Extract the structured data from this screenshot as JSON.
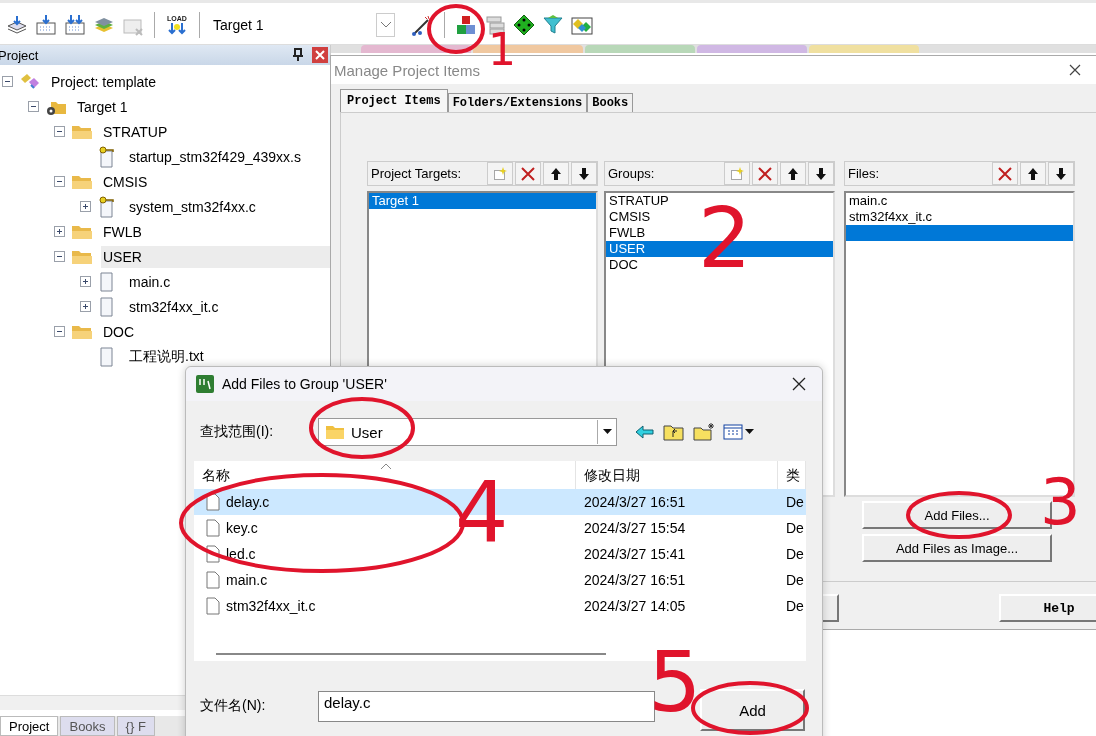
{
  "toolbar": {
    "load_label": "LOAD",
    "target": "Target 1"
  },
  "project_panel": {
    "title": "Project",
    "tree": [
      {
        "label": "Project: template",
        "kind": "project",
        "expanded": true,
        "selected": false,
        "children": [
          {
            "label": "Target 1",
            "kind": "target",
            "expanded": true,
            "selected": false,
            "children": [
              {
                "label": "STRATUP",
                "kind": "group",
                "expanded": true,
                "selected": false,
                "children": [
                  {
                    "label": "startup_stm32f429_439xx.s",
                    "kind": "keyfile",
                    "selected": false
                  }
                ]
              },
              {
                "label": "CMSIS",
                "kind": "group",
                "expanded": true,
                "selected": false,
                "children": [
                  {
                    "label": "system_stm32f4xx.c",
                    "kind": "keyfile",
                    "expanded": false,
                    "selected": false
                  }
                ]
              },
              {
                "label": "FWLB",
                "kind": "group",
                "expanded": false,
                "selected": false
              },
              {
                "label": "USER",
                "kind": "group",
                "expanded": true,
                "selected": true,
                "children": [
                  {
                    "label": "main.c",
                    "kind": "file",
                    "expanded": false,
                    "selected": false
                  },
                  {
                    "label": "stm32f4xx_it.c",
                    "kind": "file",
                    "expanded": false,
                    "selected": false
                  }
                ]
              },
              {
                "label": "DOC",
                "kind": "group",
                "expanded": true,
                "selected": false,
                "children": [
                  {
                    "label": "工程说明.txt",
                    "kind": "file",
                    "selected": false
                  }
                ]
              }
            ]
          }
        ]
      }
    ],
    "tabs": [
      {
        "label": "Project",
        "selected": true
      },
      {
        "label": "Books",
        "selected": false
      },
      {
        "label": "{} F",
        "selected": false
      }
    ]
  },
  "manage_dialog": {
    "title": "Manage Project Items",
    "tabs": [
      {
        "label": "Project Items",
        "selected": true
      },
      {
        "label": "Folders/Extensions",
        "selected": false
      },
      {
        "label": "Books",
        "selected": false
      }
    ],
    "columns": [
      {
        "label": "Project Targets:",
        "can_new": true,
        "items": [
          {
            "label": "Target 1",
            "selected": true
          }
        ]
      },
      {
        "label": "Groups:",
        "can_new": true,
        "items": [
          {
            "label": "STRATUP",
            "selected": false
          },
          {
            "label": "CMSIS",
            "selected": false
          },
          {
            "label": "FWLB",
            "selected": false
          },
          {
            "label": "USER",
            "selected": true
          },
          {
            "label": "DOC",
            "selected": false
          }
        ]
      },
      {
        "label": "Files:",
        "can_new": false,
        "blank_row_selected": true,
        "items": [
          {
            "label": "main.c",
            "selected": false
          },
          {
            "label": "stm32f4xx_it.c",
            "selected": false
          }
        ]
      }
    ],
    "add_buttons": [
      "Add Files...",
      "Add Files as Image..."
    ],
    "help": "Help"
  },
  "add_dialog": {
    "title": "Add Files to Group 'USER'",
    "look_in_label": "查找范围(I):",
    "look_in": "User",
    "columns": [
      "名称",
      "修改日期",
      "类"
    ],
    "rows": [
      {
        "name": "delay.c",
        "date": "2024/3/27 16:51",
        "type": "De",
        "selected": true
      },
      {
        "name": "key.c",
        "date": "2024/3/27 15:54",
        "type": "De",
        "selected": false
      },
      {
        "name": "led.c",
        "date": "2024/3/27 15:41",
        "type": "De",
        "selected": false
      },
      {
        "name": "main.c",
        "date": "2024/3/27 16:51",
        "type": "De",
        "selected": false
      },
      {
        "name": "stm32f4xx_it.c",
        "date": "2024/3/27 14:05",
        "type": "De",
        "selected": false
      }
    ],
    "filename_label": "文件名(N):",
    "filename": "delay.c",
    "add": "Add"
  },
  "annotations": [
    {
      "label": "1"
    },
    {
      "label": "2"
    },
    {
      "label": "3"
    },
    {
      "label": "4"
    },
    {
      "label": "5"
    }
  ]
}
